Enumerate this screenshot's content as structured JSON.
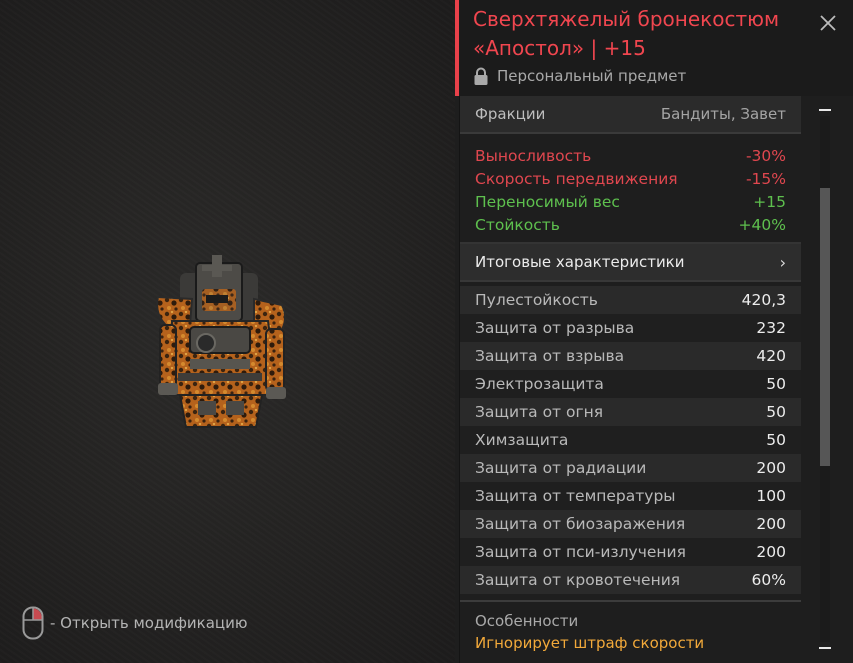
{
  "preview": {
    "hint_text": "- Открыть модификацию",
    "mouse_icon": "mouse-right-click-icon",
    "item_image": "armor-suit-image"
  },
  "item": {
    "title": "Сверхтяжелый бронекостюм «Апостол» | +15",
    "personal_label": "Персональный предмет",
    "lock_icon": "lock-icon",
    "accent_color": "#e9414a"
  },
  "factions": {
    "label": "Фракции",
    "value": "Бандиты, Завет"
  },
  "modifiers": [
    {
      "label": "Выносливость",
      "value": "-30%",
      "type": "negative"
    },
    {
      "label": "Скорость передвижения",
      "value": "-15%",
      "type": "negative"
    },
    {
      "label": "Переносимый вес",
      "value": "+15",
      "type": "positive"
    },
    {
      "label": "Стойкость",
      "value": "+40%",
      "type": "positive"
    }
  ],
  "totals": {
    "label": "Итоговые характеристики",
    "chevron": "›"
  },
  "stats": [
    {
      "label": "Пулестойкость",
      "value": "420,3"
    },
    {
      "label": "Защита от разрыва",
      "value": "232"
    },
    {
      "label": "Защита от взрыва",
      "value": "420"
    },
    {
      "label": "Электрозащита",
      "value": "50"
    },
    {
      "label": "Защита от огня",
      "value": "50"
    },
    {
      "label": "Химзащита",
      "value": "50"
    },
    {
      "label": "Защита от радиации",
      "value": "200"
    },
    {
      "label": "Защита от температуры",
      "value": "100"
    },
    {
      "label": "Защита от биозаражения",
      "value": "200"
    },
    {
      "label": "Защита от пси-излучения",
      "value": "200"
    },
    {
      "label": "Защита от кровотечения",
      "value": "60%"
    }
  ],
  "features": {
    "title": "Особенности",
    "items": [
      "Игнорирует штраф скорости"
    ]
  },
  "colors": {
    "negative": "#e0474f",
    "positive": "#5ec04e",
    "feature": "#f2a93a"
  }
}
